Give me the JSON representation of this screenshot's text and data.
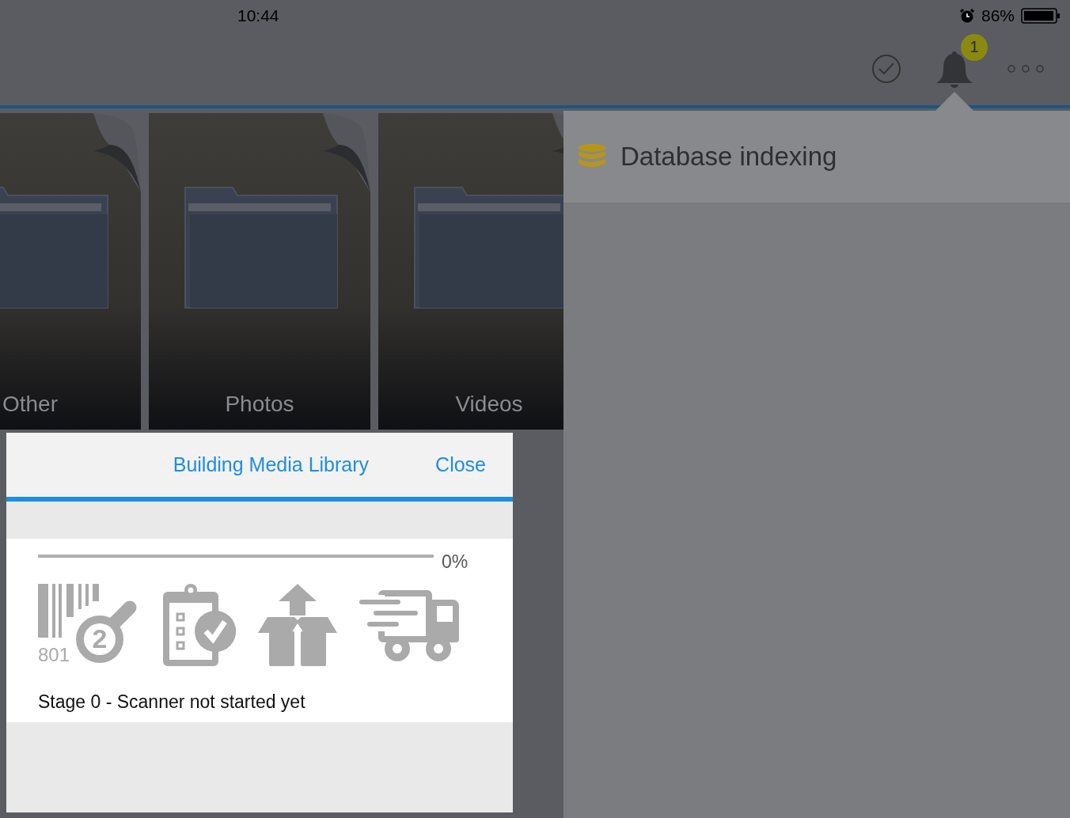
{
  "status_bar": {
    "time": "10:44",
    "battery_text": "86%"
  },
  "toolbar": {
    "notification_count": "1"
  },
  "tiles": [
    {
      "label": "Other"
    },
    {
      "label": "Photos"
    },
    {
      "label": "Videos"
    }
  ],
  "notifications": [
    {
      "title": "Database indexing"
    }
  ],
  "dialog": {
    "title": "Building Media Library",
    "close": "Close",
    "progress": {
      "level": 0,
      "reading": "0%"
    },
    "barcode_icon": {
      "digits": "801",
      "number": "2"
    },
    "stage_text": "Stage 0 - Scanner not started yet"
  }
}
